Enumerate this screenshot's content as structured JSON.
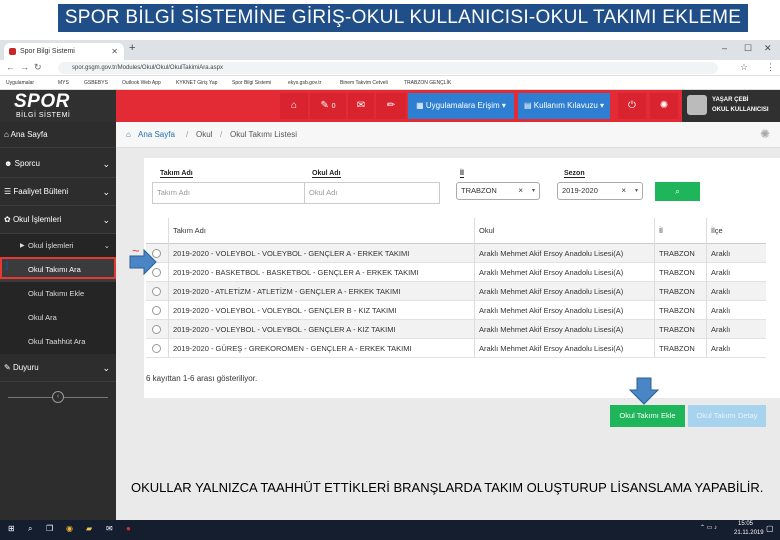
{
  "slide_title": "SPOR BİLGİ SİSTEMİNE GİRİŞ-OKUL KULLANICISI-OKUL TAKIMI EKLEME",
  "browser": {
    "tab_title": "Spor Bilgi Sistemi",
    "url": "spor.gsgm.gov.tr/Modules/Okul/Okul/OkulTakimiAra.aspx",
    "bookmarks": [
      "Uygulamalar",
      "MYS",
      "GSBEBYS",
      "Outlook Web App",
      "KYKNET Giriş Yap",
      "Spor Bilgi Sistemi",
      "ekys.gsb.gov.tr",
      "Binem Takvim Cetveli",
      "TRABZON GENÇLİK"
    ]
  },
  "header": {
    "logo_main": "SPOR",
    "logo_sub": "BİLGİ SİSTEMİ",
    "badge_count": "0",
    "apps_label": "Uygulamalara Erişim",
    "guide_label": "Kullanım Kılavuzu",
    "user_name": "YAŞAR ÇEBİ",
    "user_role": "OKUL KULLANICISI"
  },
  "sidebar": {
    "items": [
      {
        "label": "Ana Sayfa"
      },
      {
        "label": "Sporcu"
      },
      {
        "label": "Faaliyet Bülteni"
      },
      {
        "label": "Okul İşlemleri"
      }
    ],
    "sub_items": [
      {
        "label": "Okul İşlemleri"
      },
      {
        "label": "Okul Takımı Ara"
      },
      {
        "label": "Okul Takımı Ekle"
      },
      {
        "label": "Okul Ara"
      },
      {
        "label": "Okul Taahhüt Ara"
      }
    ],
    "duyuru": "Duyuru"
  },
  "breadcrumb": {
    "home": "Ana Sayfa",
    "level1": "Okul",
    "level2": "Okul Takımı Listesi"
  },
  "filters": {
    "team_label": "Takım Adı",
    "team_placeholder": "Takım Adı",
    "school_label": "Okul Adı",
    "school_placeholder": "Okul Adı",
    "city_label": "İl",
    "city_value": "TRABZON",
    "season_label": "Sezon",
    "season_value": "2019-2020"
  },
  "table": {
    "headers": [
      "Takım Adı",
      "Okul",
      "İl",
      "İlçe"
    ],
    "rows": [
      [
        "2019-2020 - VOLEYBOL - VOLEYBOL - GENÇLER A - ERKEK TAKIMI",
        "Araklı Mehmet Akif Ersoy Anadolu Lisesi(A)",
        "TRABZON",
        "Araklı"
      ],
      [
        "2019-2020 - BASKETBOL - BASKETBOL - GENÇLER A - ERKEK TAKIMI",
        "Araklı Mehmet Akif Ersoy Anadolu Lisesi(A)",
        "TRABZON",
        "Araklı"
      ],
      [
        "2019-2020 - ATLETİZM - ATLETİZM - GENÇLER A - ERKEK TAKIMI",
        "Araklı Mehmet Akif Ersoy Anadolu Lisesi(A)",
        "TRABZON",
        "Araklı"
      ],
      [
        "2019-2020 - VOLEYBOL - VOLEYBOL - GENÇLER B - KIZ TAKIMI",
        "Araklı Mehmet Akif Ersoy Anadolu Lisesi(A)",
        "TRABZON",
        "Araklı"
      ],
      [
        "2019-2020 - VOLEYBOL - VOLEYBOL - GENÇLER A - KIZ TAKIMI",
        "Araklı Mehmet Akif Ersoy Anadolu Lisesi(A)",
        "TRABZON",
        "Araklı"
      ],
      [
        "2019-2020 - GÜREŞ - GREKOROMEN - GENÇLER A - ERKEK TAKIMI",
        "Araklı Mehmet Akif Ersoy Anadolu Lisesi(A)",
        "TRABZON",
        "Araklı"
      ]
    ],
    "footer": "6 kayıttan 1-6 arası gösteriliyor."
  },
  "actions": {
    "add_label": "Okul Takımı Ekle",
    "disabled_label": "Okul Takımı Detay"
  },
  "annotations": {
    "marker_number": "1",
    "arrow_color": "#4a86c5",
    "highlight_color": "#e53935"
  },
  "note": "OKULLAR YALNIZCA TAAHHÜT ETTİKLERİ BRANŞLARDA TAKIM OLUŞTURUP LİSANSLAMA YAPABİLİR.",
  "taskbar": {
    "time": "15:05",
    "date": "21.11.2019"
  },
  "colors": {
    "brand_red": "#e32b36",
    "sidebar_dark": "#2d2d2d",
    "success_green": "#1fb55a",
    "title_blue": "#1f4e89"
  }
}
